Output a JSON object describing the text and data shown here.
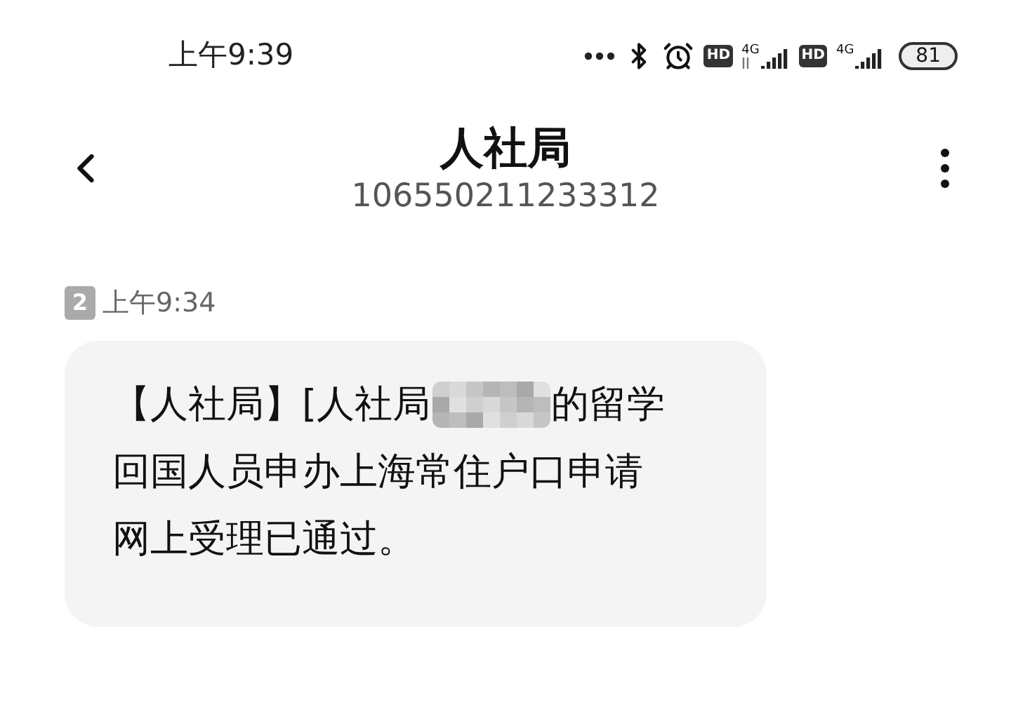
{
  "status_bar": {
    "time": "上午9:39",
    "sims": [
      {
        "hd": "HD",
        "network": "4G",
        "activity": true
      },
      {
        "hd": "HD",
        "network": "4G",
        "activity": false
      }
    ],
    "battery": "81"
  },
  "header": {
    "title": "人社局",
    "number": "106550211233312"
  },
  "messages": [
    {
      "sim": "2",
      "time": "上午9:34",
      "lines": [
        [
          {
            "kind": "text",
            "text": "【人社局】[人社局"
          },
          {
            "kind": "redacted"
          },
          {
            "kind": "text",
            "text": "的留学"
          }
        ],
        [
          {
            "kind": "text",
            "text": "回国人员申办上海常住户口申请"
          }
        ],
        [
          {
            "kind": "text",
            "text": "网上受理已通过。"
          }
        ]
      ]
    }
  ]
}
